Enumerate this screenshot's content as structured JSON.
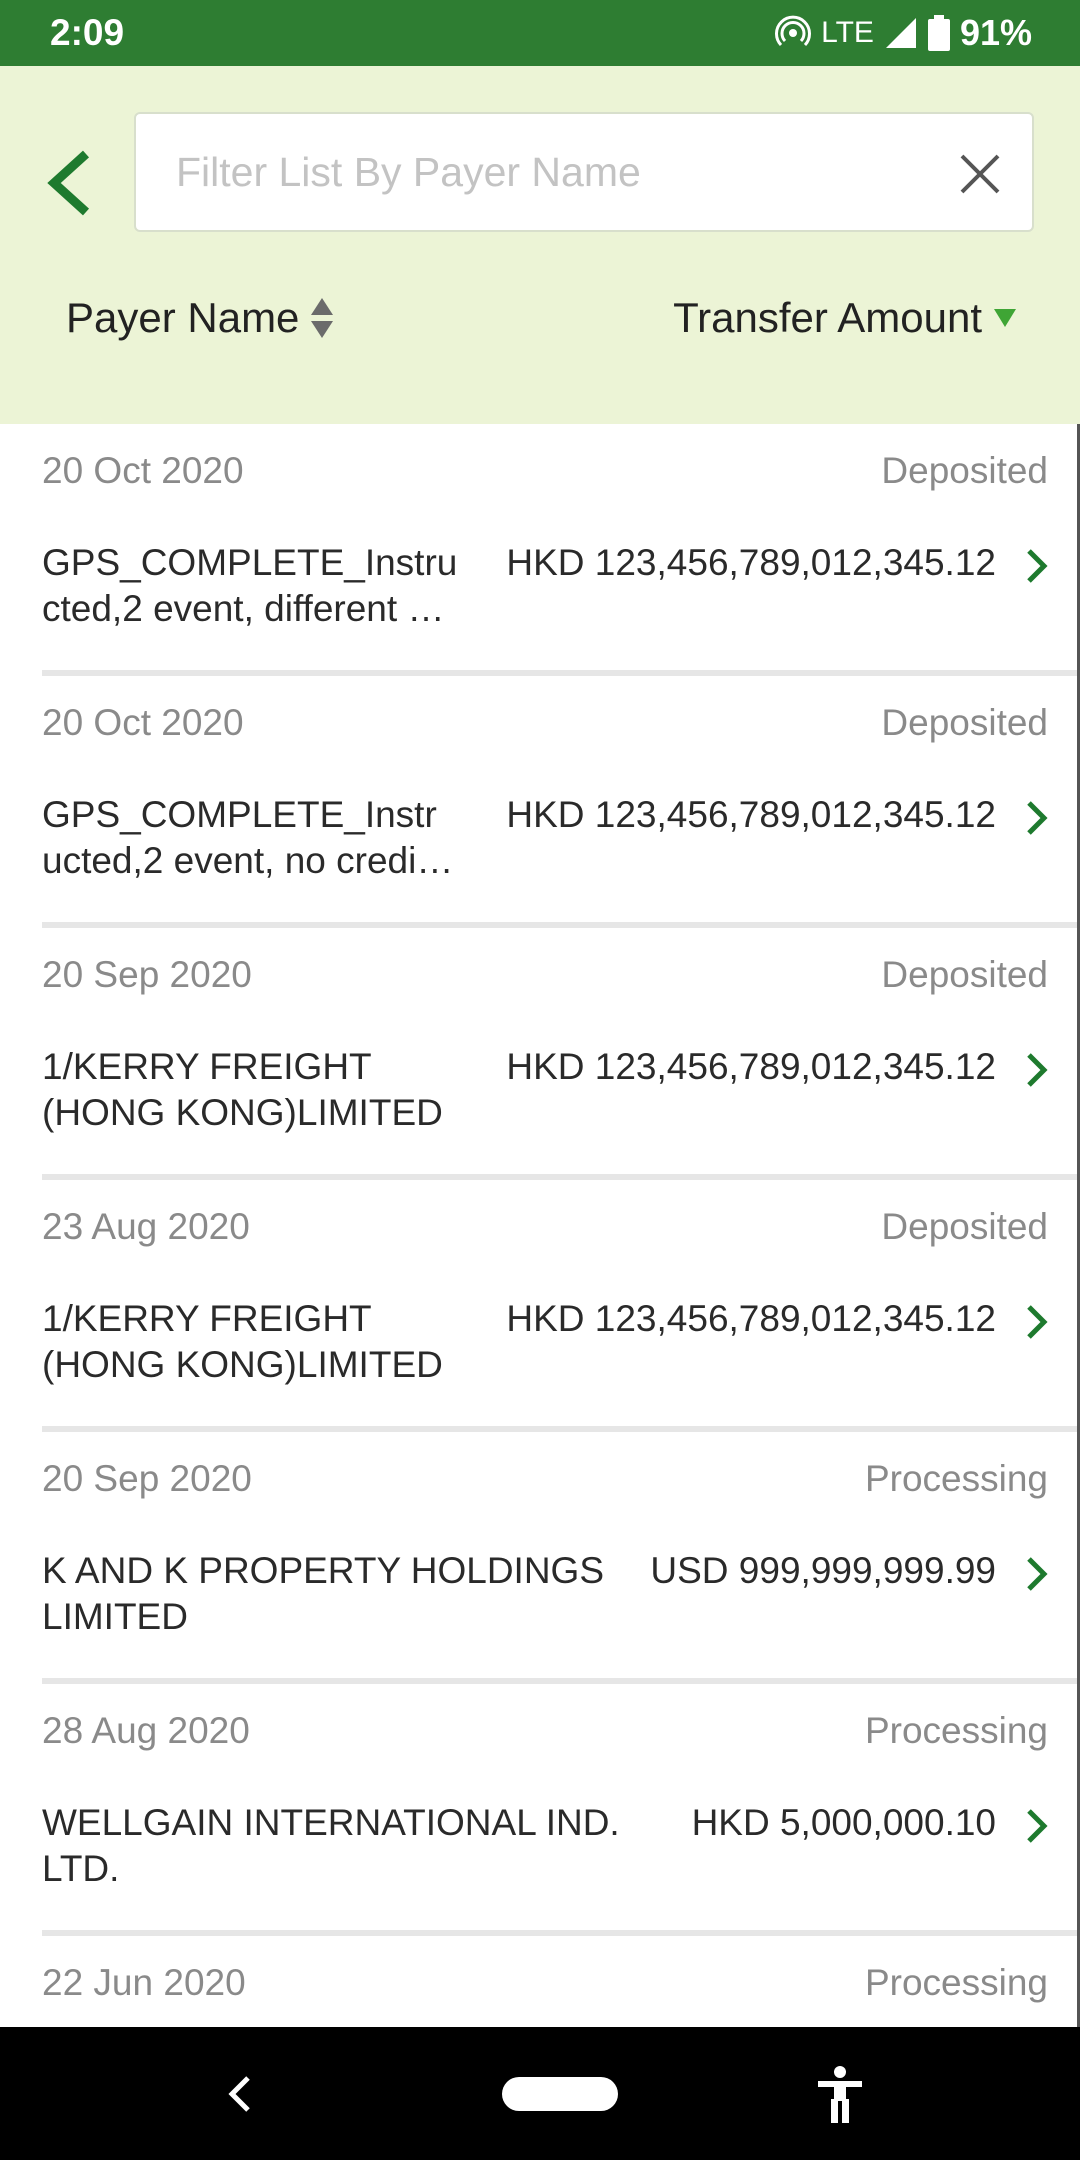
{
  "status_bar": {
    "time": "2:09",
    "network": "LTE",
    "battery": "91%"
  },
  "search": {
    "placeholder": "Filter List By Payer Name",
    "value": ""
  },
  "sort": {
    "payer_label": "Payer Name",
    "amount_label": "Transfer Amount",
    "active": "amount",
    "direction": "descending"
  },
  "items": [
    {
      "date": "20 Oct 2020",
      "status": "Deposited",
      "payer": "GPS_COMPLETE_Instru cted,2 event, different …",
      "amount": "HKD 123,456,789,012,345.12"
    },
    {
      "date": "20 Oct 2020",
      "status": "Deposited",
      "payer": "GPS_COMPLETE_Instr ucted,2 event, no credi…",
      "amount": "HKD 123,456,789,012,345.12"
    },
    {
      "date": "20 Sep 2020",
      "status": "Deposited",
      "payer": "1/KERRY FREIGHT (HONG KONG)LIMITED",
      "amount": "HKD 123,456,789,012,345.12"
    },
    {
      "date": "23 Aug 2020",
      "status": "Deposited",
      "payer": "1/KERRY FREIGHT (HONG KONG)LIMITED",
      "amount": "HKD 123,456,789,012,345.12"
    },
    {
      "date": "20 Sep 2020",
      "status": "Processing",
      "payer": "K AND K PROPERTY HOLDINGS LIMITED",
      "amount": "USD 999,999,999.99"
    },
    {
      "date": "28 Aug 2020",
      "status": "Processing",
      "payer": "WELLGAIN INTERNATIONAL IND. LTD.",
      "amount": "HKD 5,000,000.10"
    },
    {
      "date": "22 Jun 2020",
      "status": "Processing",
      "payer": "",
      "amount": ""
    }
  ],
  "colors": {
    "status_bar": "#2e7d32",
    "header_bg": "#ecf4d6",
    "accent": "#1e7a2e",
    "sort_active": "#3fa535"
  },
  "icons": {
    "back": "chevron-left-icon",
    "clear": "close-icon",
    "sort_both": "sort-up-down-icon",
    "sort_desc": "sort-down-icon",
    "row": "chevron-right-icon"
  }
}
